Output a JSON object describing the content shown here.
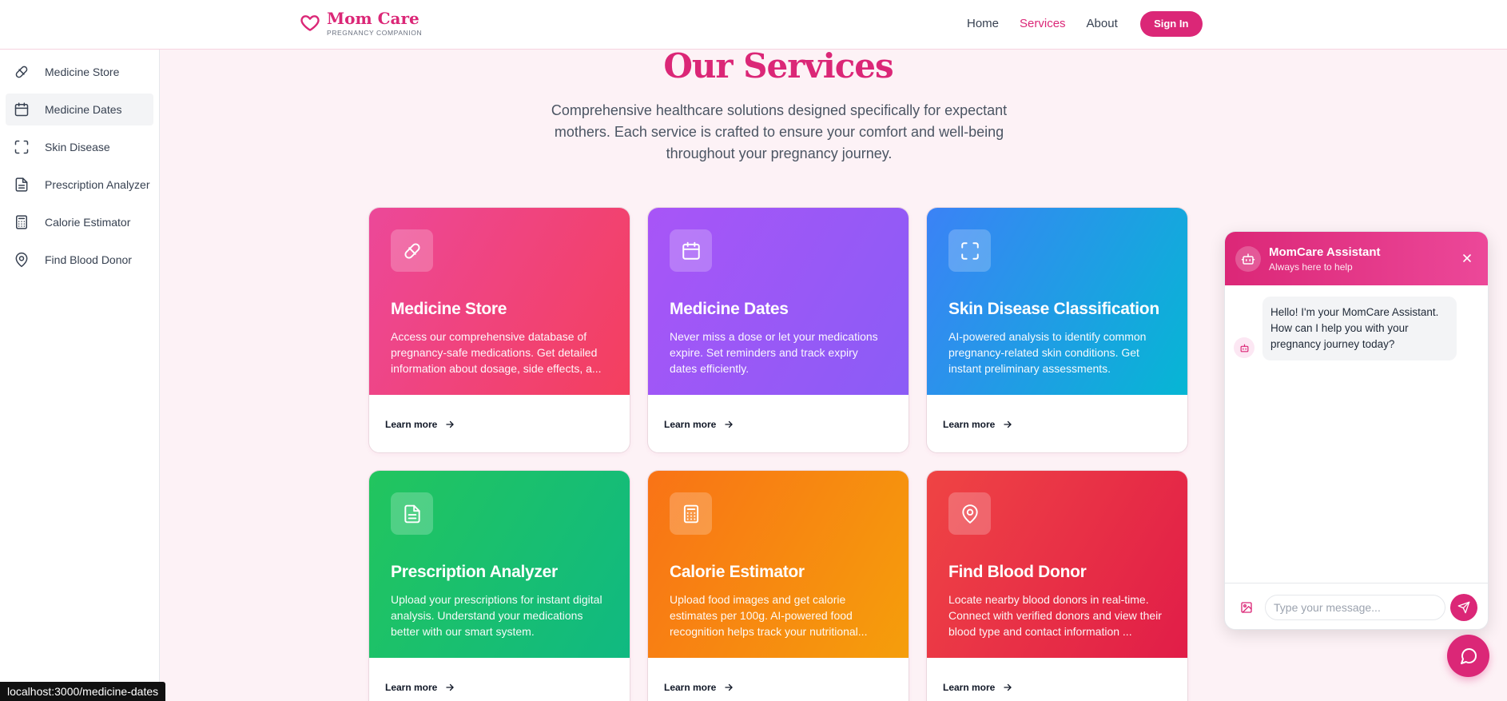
{
  "header": {
    "brand_name": "Mom Care",
    "brand_tagline": "PREGNANCY COMPANION",
    "nav": [
      {
        "label": "Home",
        "active": false
      },
      {
        "label": "Services",
        "active": true
      },
      {
        "label": "About",
        "active": false
      }
    ],
    "signin_label": "Sign In",
    "accent": "#db2777"
  },
  "sidebar": {
    "items": [
      {
        "label": "Medicine Store",
        "icon": "pill-icon",
        "active": false
      },
      {
        "label": "Medicine Dates",
        "icon": "calendar-icon",
        "active": true
      },
      {
        "label": "Skin Disease",
        "icon": "scan-icon",
        "active": false
      },
      {
        "label": "Prescription Analyzer",
        "icon": "document-icon",
        "active": false
      },
      {
        "label": "Calorie Estimator",
        "icon": "calculator-icon",
        "active": false
      },
      {
        "label": "Find Blood Donor",
        "icon": "map-pin-icon",
        "active": false
      }
    ]
  },
  "main": {
    "title": "Our Services",
    "subtitle": "Comprehensive healthcare solutions designed specifically for expectant mothers. Each service is crafted to ensure your comfort and well-being throughout your pregnancy journey.",
    "cards": [
      {
        "title": "Medicine Store",
        "description": "Access our comprehensive database of pregnancy-safe medications. Get detailed information about dosage, side effects, a...",
        "cta": "Learn more",
        "icon": "pill-icon",
        "gradient": [
          "#ec4899",
          "#f43f5e"
        ]
      },
      {
        "title": "Medicine Dates",
        "description": "Never miss a dose or let your medications expire. Set reminders and track expiry dates efficiently.",
        "cta": "Learn more",
        "icon": "calendar-icon",
        "gradient": [
          "#a855f7",
          "#8b5cf6"
        ]
      },
      {
        "title": "Skin Disease Classification",
        "description": "AI-powered analysis to identify common pregnancy-related skin conditions. Get instant preliminary assessments.",
        "cta": "Learn more",
        "icon": "scan-icon",
        "gradient": [
          "#3b82f6",
          "#06b6d4"
        ]
      },
      {
        "title": "Prescription Analyzer",
        "description": "Upload your prescriptions for instant digital analysis. Understand your medications better with our smart system.",
        "cta": "Learn more",
        "icon": "document-icon",
        "gradient": [
          "#22c55e",
          "#10b981"
        ]
      },
      {
        "title": "Calorie Estimator",
        "description": "Upload food images and get calorie estimates per 100g. AI-powered food recognition helps track your nutritional...",
        "cta": "Learn more",
        "icon": "calculator-icon",
        "gradient": [
          "#f97316",
          "#f59e0b"
        ]
      },
      {
        "title": "Find Blood Donor",
        "description": "Locate nearby blood donors in real-time. Connect with verified donors and view their blood type and contact information ...",
        "cta": "Learn more",
        "icon": "map-pin-icon",
        "gradient": [
          "#ef4444",
          "#e11d48"
        ]
      }
    ]
  },
  "chat": {
    "title": "MomCare Assistant",
    "subtitle": "Always here to help",
    "messages": [
      {
        "from": "bot",
        "text": "Hello! I'm your MomCare Assistant. How can I help you with your pregnancy journey today?"
      }
    ],
    "input_placeholder": "Type your message...",
    "input_value": ""
  },
  "status_bar": {
    "url": "localhost:3000/medicine-dates"
  }
}
